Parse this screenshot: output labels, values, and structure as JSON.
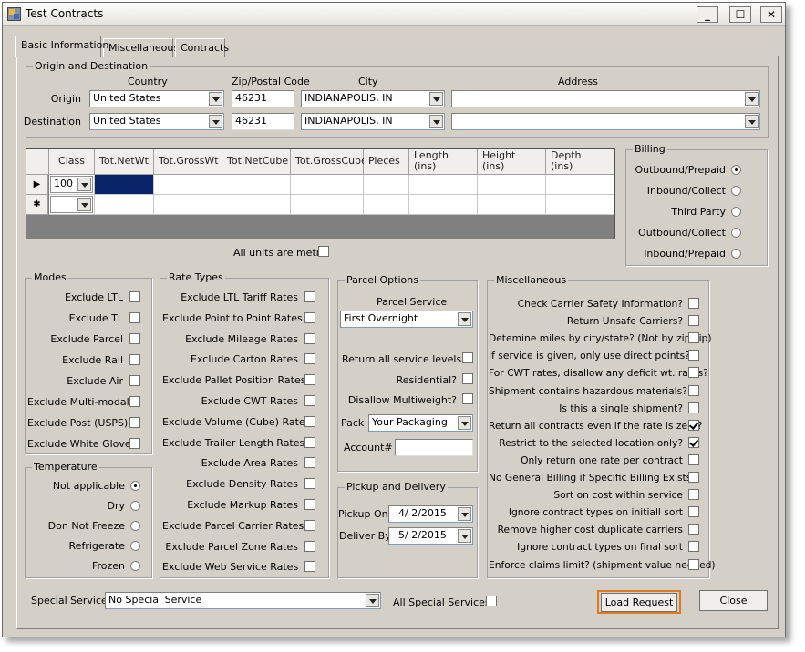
{
  "window": {
    "title": "Test Contracts",
    "min": "_",
    "max": "☐",
    "close": "✕"
  },
  "tabs": [
    "Basic Information",
    "Miscellaneous",
    "Contracts"
  ],
  "origin_dest": {
    "group": "Origin and Destination",
    "col_country": "Country",
    "col_zip": "Zip/Postal Code",
    "col_city": "City",
    "col_address": "Address",
    "origin": {
      "label": "Origin",
      "country": "United States",
      "zip": "46231",
      "city": "INDIANAPOLIS, IN",
      "address": ""
    },
    "destination": {
      "label": "Destination",
      "country": "United States",
      "zip": "46231",
      "city": "INDIANAPOLIS, IN",
      "address": ""
    }
  },
  "grid": {
    "headers": [
      "Class",
      "Tot.NetWt",
      "Tot.GrossWt",
      "Tot.NetCube",
      "Tot.GrossCube",
      "Pieces",
      "Length\n(ins)",
      "Height\n(ins)",
      "Depth\n(ins)"
    ],
    "row_markers": [
      "▶",
      "✱"
    ],
    "class_value": "100"
  },
  "metric_label": "All units are metric",
  "billing": {
    "group": "Billing",
    "options": [
      "Outbound/Prepaid",
      "Inbound/Collect",
      "Third Party",
      "Outbound/Collect",
      "Inbound/Prepaid"
    ],
    "selected": 0
  },
  "modes": {
    "group": "Modes",
    "items": [
      "Exclude LTL",
      "Exclude TL",
      "Exclude Parcel",
      "Exclude Rail",
      "Exclude Air",
      "Exclude Multi-modal",
      "Exclude Post (USPS)",
      "Exclude White Glove"
    ]
  },
  "temperature": {
    "group": "Temperature",
    "options": [
      "Not applicable",
      "Dry",
      "Don Not Freeze",
      "Refrigerate",
      "Frozen"
    ],
    "selected": 0
  },
  "rate_types": {
    "group": "Rate Types",
    "items": [
      "Exclude LTL Tariff Rates",
      "Exclude Point to Point Rates",
      "Exclude Mileage Rates",
      "Exclude Carton Rates",
      "Exclude Pallet Position Rates",
      "Exclude CWT Rates",
      "Exclude Volume (Cube) Rates",
      "Exclude Trailer Length Rates",
      "Exclude Area Rates",
      "Exclude Density Rates",
      "Exclude Markup Rates",
      "Exclude Parcel Carrier Rates",
      "Exclude Parcel Zone Rates",
      "Exclude Web Service Rates"
    ]
  },
  "parcel": {
    "group": "Parcel Options",
    "service_label": "Parcel Service",
    "service": "First Overnight",
    "return_all": "Return all service levels",
    "residential": "Residential?",
    "disallow": "Disallow Multiweight?",
    "pack_label": "Pack",
    "pack": "Your Packaging",
    "account_label": "Account#",
    "account": ""
  },
  "pickup": {
    "group": "Pickup and Delivery",
    "pickup_label": "Pickup On",
    "pickup": "4/ 2/2015",
    "deliver_label": "Deliver By",
    "deliver": "5/ 2/2015"
  },
  "misc": {
    "group": "Miscellaneous",
    "items": [
      "Check Carrier Safety Information?",
      "Return Unsafe Carriers?",
      "Detemine miles by city/state? (Not by zip/zip)",
      "If service is given, only use direct points?",
      "For CWT rates, disallow any deficit wt. rates?",
      "Shipment contains hazardous materials?",
      "Is this a single shipment?",
      "Return all contracts even if the rate is zero?",
      "Restrict to the selected location only?",
      "Only return one rate per contract",
      "No General Billing if Specific Billing Exists",
      "Sort on cost within service",
      "Ignore contract types on initiall sort",
      "Remove higher cost duplicate carriers",
      "Ignore contract types on final sort",
      "Enforce claims limit? (shipment value needed)"
    ],
    "checked": [
      7,
      8
    ]
  },
  "special": {
    "label": "Special Service",
    "value": "No Special Service",
    "all_label": "All Special Services"
  },
  "buttons": {
    "load": "Load Request",
    "close": "Close"
  },
  "colors": {
    "highlight_border": "#e07a1f",
    "grid_selected": "#0a246a"
  }
}
